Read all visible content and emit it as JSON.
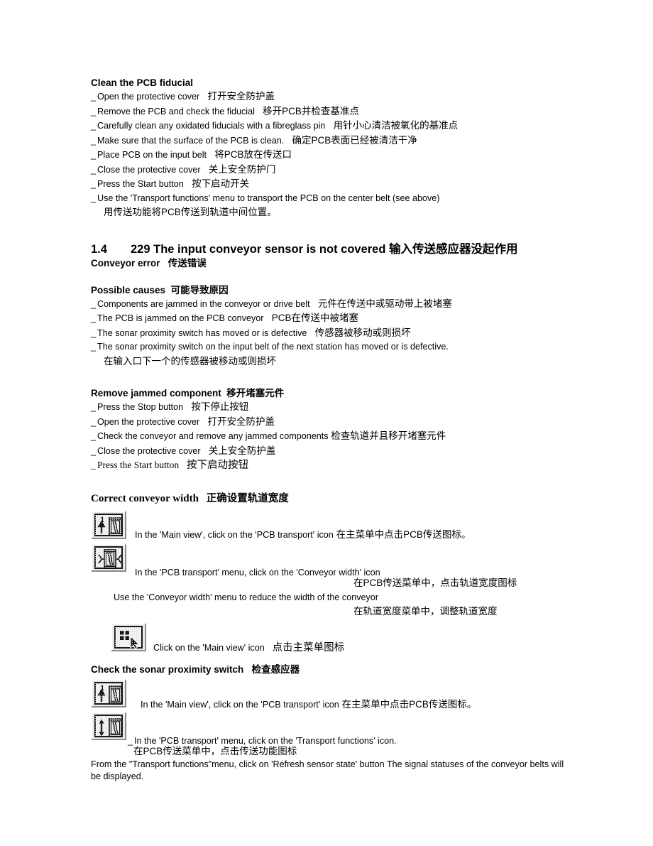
{
  "document": {
    "sections": [
      {
        "id": "clean-pcb-fiducial",
        "heading": "Clean the PCB fiducial",
        "items": [
          {
            "en": "Open the protective cover",
            "cn": "打开安全防护盖"
          },
          {
            "en": "Remove the PCB and check the fiducial",
            "cn": "移开PCB并检查基准点"
          },
          {
            "en": "Carefully clean any oxidated fiducials with a fibreglass pin",
            "cn": "用针小心清洁被氧化的基准点"
          },
          {
            "en": "Make sure that the surface of the PCB is clean.",
            "cn": "确定PCB表面已经被清洁干净"
          },
          {
            "en": "Place PCB on the input belt",
            "cn": "将PCB放在传送口"
          },
          {
            "en": "Close the protective cover",
            "cn": "关上安全防护门"
          },
          {
            "en": "Press the Start button",
            "cn": "按下启动开关"
          },
          {
            "en": "Use the 'Transport functions' menu to transport the PCB on the center belt (see above)",
            "cn": ""
          }
        ],
        "trailing_cn": "用传送功能将PCB传送到轨道中间位置。"
      }
    ],
    "section_1_4": {
      "number": "1.4",
      "title_en": "229 The input conveyor sensor is not covered",
      "title_cn": "输入传送感应器没起作用",
      "subtitle_en": "Conveyor error",
      "subtitle_cn": "传送错误",
      "possible_causes": {
        "heading_en": "Possible causes",
        "heading_cn": "可能导致原因",
        "items": [
          {
            "en": "Components are jammed in the conveyor or drive belt",
            "cn": "元件在传送中或驱动带上被堵塞"
          },
          {
            "en": "The PCB is jammed on the PCB conveyor",
            "cn": "PCB在传送中被堵塞"
          },
          {
            "en": "The sonar proximity switch has moved or is defective",
            "cn": "传感器被移动或则损坏"
          },
          {
            "en": "The sonar proximity switch on the input belt of the next station has moved or is defective.",
            "cn": ""
          }
        ],
        "trailing_cn": "在输入口下一个的传感器被移动或则损坏"
      },
      "remove_jammed": {
        "heading_en": "Remove jammed component",
        "heading_cn": "移开堵塞元件",
        "items": [
          {
            "en": "Press the Stop button",
            "cn": "按下停止按钮"
          },
          {
            "en": "Open the protective cover",
            "cn": "打开安全防护盖"
          },
          {
            "en": "Check the conveyor and remove any jammed components",
            "cn": "检查轨道并且移开堵塞元件"
          },
          {
            "en": "Close the protective cover",
            "cn": "关上安全防护盖"
          }
        ],
        "last_item": {
          "en": "Press the Start button",
          "cn": "按下启动按钮"
        }
      },
      "correct_conveyor_width": {
        "heading_en": "Correct conveyor width",
        "heading_cn": "正确设置轨道宽度",
        "step1": {
          "icon": "pcb-transport-icon",
          "en": "In the 'Main view', click on the 'PCB transport' icon",
          "cn": "在主菜单中点击PCB传送图标。"
        },
        "step2": {
          "icon": "conveyor-width-icon",
          "en": "In the 'PCB transport' menu, click on the 'Conveyor width' icon",
          "cn": "在PCB传送菜单中，点击轨道宽度图标"
        },
        "step3": {
          "en": "Use the 'Conveyor width' menu to reduce the width of the conveyor",
          "cn": "在轨道宽度菜单中，调整轨道宽度"
        },
        "step4": {
          "icon": "main-view-icon",
          "en": "Click on the 'Main view' icon",
          "cn": "点击主菜单图标"
        }
      },
      "check_sonar": {
        "heading_en": "Check the sonar proximity switch",
        "heading_cn": "检查感应器",
        "step1": {
          "icon": "pcb-transport-icon",
          "en": "In the 'Main view', click on the 'PCB transport' icon",
          "cn": "在主菜单中点击PCB传送图标。"
        },
        "step2": {
          "icon": "transport-functions-icon",
          "en": "In the 'PCB transport' menu, click on the 'Transport functions' icon.",
          "cn": "在PCB传送菜单中，点击传送功能图标"
        },
        "closing_paragraph": "From the \"Transport functions\"menu, click on 'Refresh sensor state' button The signal statuses of the conveyor belts will be displayed."
      }
    }
  },
  "colors": {
    "text": "#000000",
    "page_background": "#ffffff",
    "icon_face": "#efefef",
    "icon_highlight": "#ffffff",
    "icon_shadow": "#8a8a8a",
    "icon_border": "#1a1a1a"
  }
}
